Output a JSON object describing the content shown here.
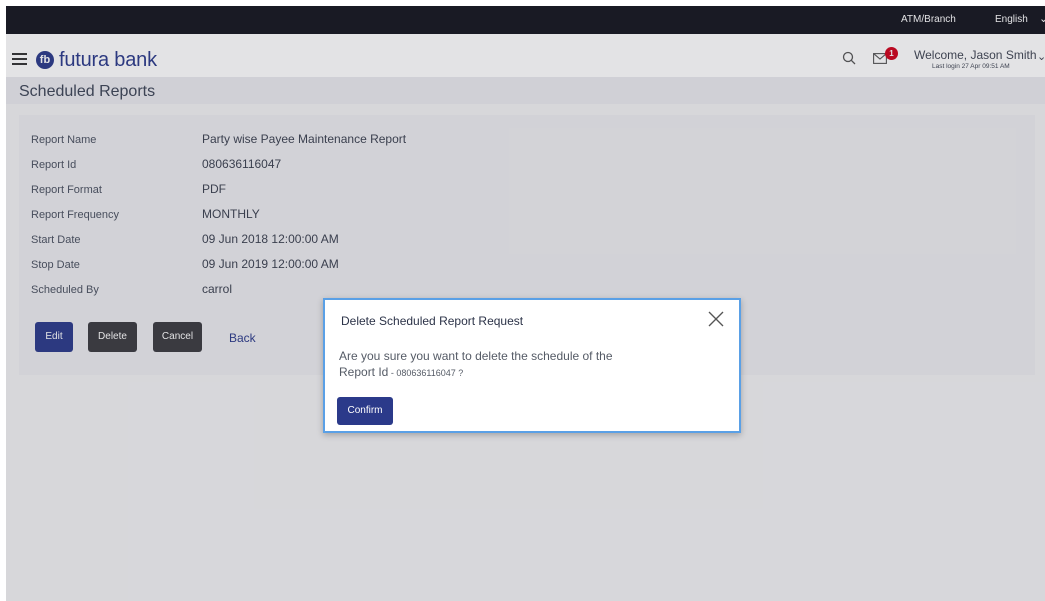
{
  "topbar": {
    "atm_branch": "ATM/Branch",
    "language": "English"
  },
  "header": {
    "brand": "futura bank",
    "notification_count": "1",
    "welcome": "Welcome, Jason Smith",
    "last_login": "Last login 27 Apr 09:51 AM"
  },
  "page": {
    "title": "Scheduled Reports"
  },
  "details": [
    {
      "label": "Report Name",
      "value": "Party wise Payee Maintenance Report"
    },
    {
      "label": "Report Id",
      "value": "080636116047"
    },
    {
      "label": "Report Format",
      "value": "PDF"
    },
    {
      "label": "Report Frequency",
      "value": "MONTHLY"
    },
    {
      "label": "Start Date",
      "value": "09 Jun 2018 12:00:00 AM"
    },
    {
      "label": "Stop Date",
      "value": "09 Jun 2019 12:00:00 AM"
    },
    {
      "label": "Scheduled By",
      "value": "carrol"
    }
  ],
  "actions": {
    "edit": "Edit",
    "delete": "Delete",
    "cancel": "Cancel",
    "back": "Back"
  },
  "modal": {
    "title": "Delete Scheduled Report Request",
    "line1": "Are you sure you want to delete the schedule of the",
    "line2_prefix": "Report Id",
    "line2_value": " - 080636116047 ?",
    "confirm": "Confirm"
  },
  "colors": {
    "brand": "#2b3a8a",
    "topbar": "#14151f",
    "badge": "#d0021b",
    "modal_border": "#5aa0e6"
  }
}
